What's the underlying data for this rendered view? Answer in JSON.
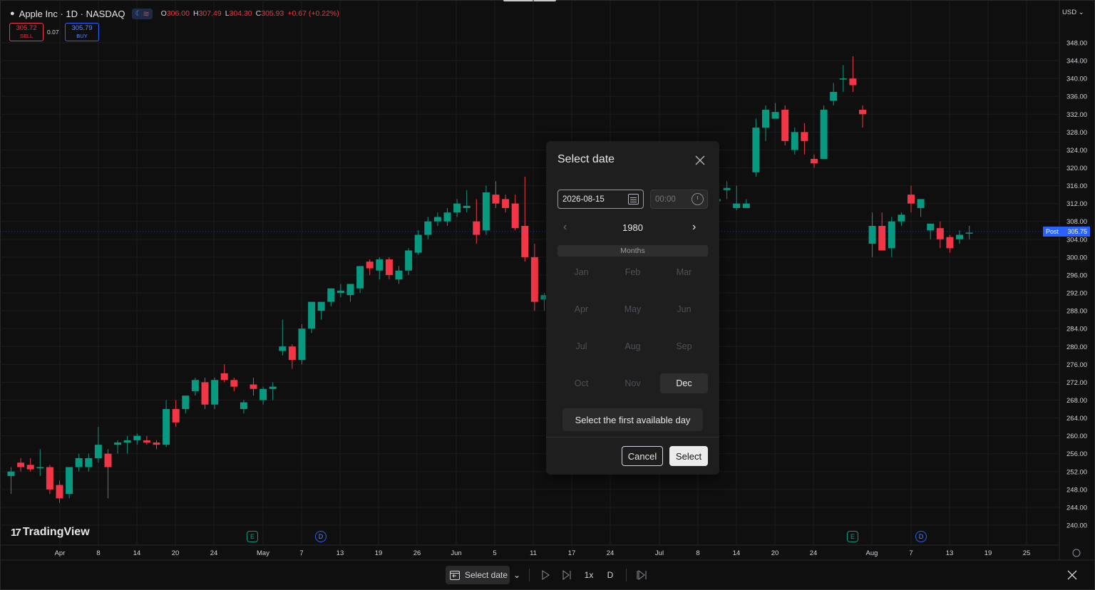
{
  "header": {
    "title": "Apple Inc · 1D · NASDAQ",
    "ohlc": [
      {
        "key": "O",
        "value": "306.00"
      },
      {
        "key": "H",
        "value": "307.49"
      },
      {
        "key": "L",
        "value": "304.30"
      },
      {
        "key": "C",
        "value": "305.93"
      },
      {
        "key": "",
        "value": "+0.67 (+0.22%)"
      }
    ]
  },
  "trade": {
    "sell_price": "305.72",
    "sell_label": "SELL",
    "spread": "0.07",
    "buy_price": "305.79",
    "buy_label": "BUY"
  },
  "currency": "USD ⌄",
  "post_label": {
    "tag": "Post",
    "price": "305.75"
  },
  "logo": {
    "text": "TradingView",
    "mark": "17"
  },
  "events": [
    {
      "type": "E",
      "label": "E"
    },
    {
      "type": "D",
      "label": "D"
    },
    {
      "type": "E",
      "label": "E"
    },
    {
      "type": "D",
      "label": "D"
    }
  ],
  "chart_data": {
    "type": "candlestick",
    "title": "Apple Inc · 1D · NASDAQ",
    "ylim": [
      238,
      350
    ],
    "y_ticks": [
      "348.00",
      "344.00",
      "340.00",
      "336.00",
      "332.00",
      "328.00",
      "324.00",
      "320.00",
      "316.00",
      "312.00",
      "308.00",
      "304.00",
      "300.00",
      "296.00",
      "292.00",
      "288.00",
      "284.00",
      "280.00",
      "276.00",
      "272.00",
      "268.00",
      "264.00",
      "260.00",
      "256.00",
      "252.00",
      "248.00",
      "244.00",
      "240.00"
    ],
    "x_ticks": [
      "Apr",
      "8",
      "14",
      "20",
      "24",
      "May",
      "7",
      "13",
      "19",
      "26",
      "Jun",
      "5",
      "11",
      "17",
      "24",
      "Jul",
      "8",
      "14",
      "20",
      "24",
      "Aug",
      "7",
      "13",
      "19",
      "25"
    ],
    "colors": {
      "up": "#089981",
      "down": "#f23645",
      "grid": "#1c1c1c",
      "background": "#0f0f0f"
    },
    "candles": [
      [
        251.0,
        253.0,
        247.0,
        252.0
      ],
      [
        254.0,
        255.0,
        252.0,
        253.0
      ],
      [
        253.5,
        255.0,
        252.0,
        252.5
      ],
      [
        253.0,
        257.0,
        251.0,
        253.0
      ],
      [
        253.0,
        253.5,
        247.0,
        248.0
      ],
      [
        249.0,
        250.0,
        245.0,
        246.0
      ],
      [
        247.0,
        253.0,
        246.0,
        253.0
      ],
      [
        253.0,
        256.0,
        252.0,
        255.0
      ],
      [
        253.0,
        256.0,
        252.0,
        255.0
      ],
      [
        255.0,
        262.0,
        254.0,
        258.0
      ],
      [
        256.0,
        257.0,
        246.0,
        253.0
      ],
      [
        258.0,
        259.0,
        256.0,
        258.5
      ],
      [
        258.5,
        260.0,
        256.0,
        259.0
      ],
      [
        259.0,
        260.5,
        258.0,
        260.0
      ],
      [
        259.0,
        260.0,
        258.0,
        258.5
      ],
      [
        258.5,
        259.0,
        257.0,
        258.0
      ],
      [
        258.0,
        268.0,
        257.5,
        266.0
      ],
      [
        266.0,
        268.0,
        262.0,
        263.0
      ],
      [
        266.0,
        269.0,
        265.0,
        269.0
      ],
      [
        270.0,
        273.0,
        269.0,
        272.5
      ],
      [
        272.0,
        273.0,
        266.0,
        267.0
      ],
      [
        267.0,
        273.0,
        266.0,
        272.5
      ],
      [
        274.0,
        276.0,
        272.0,
        272.5
      ],
      [
        272.5,
        273.0,
        270.0,
        271.0
      ],
      [
        266.0,
        268.0,
        265.0,
        267.5
      ],
      [
        271.5,
        273.0,
        269.0,
        270.5
      ],
      [
        268.0,
        271.0,
        267.0,
        270.5
      ],
      [
        270.5,
        272.0,
        268.0,
        271.0
      ],
      [
        279.0,
        286.0,
        278.0,
        280.0
      ],
      [
        280.0,
        280.5,
        275.0,
        277.0
      ],
      [
        277.0,
        285.0,
        276.0,
        284.0
      ],
      [
        284.0,
        290.0,
        283.0,
        290.0
      ],
      [
        288.0,
        289.0,
        286.0,
        290.0
      ],
      [
        290.0,
        293.0,
        289.0,
        293.0
      ],
      [
        292.0,
        294.0,
        291.0,
        292.5
      ],
      [
        291.5,
        294.0,
        290.0,
        294.0
      ],
      [
        293.0,
        298.0,
        292.0,
        298.0
      ],
      [
        299.0,
        299.5,
        296.0,
        297.5
      ],
      [
        297.0,
        300.0,
        295.0,
        299.5
      ],
      [
        299.5,
        300.0,
        295.0,
        296.0
      ],
      [
        295.0,
        298.0,
        294.0,
        297.0
      ],
      [
        297.0,
        302.0,
        296.0,
        301.5
      ],
      [
        301.0,
        306.0,
        300.5,
        305.0
      ],
      [
        305.0,
        309.0,
        304.0,
        308.0
      ],
      [
        308.0,
        310.0,
        307.0,
        309.0
      ],
      [
        308.0,
        311.0,
        307.0,
        310.0
      ],
      [
        310.0,
        313.0,
        309.0,
        312.0
      ],
      [
        311.0,
        315.0,
        310.0,
        311.5
      ],
      [
        308.0,
        313.0,
        303.0,
        305.0
      ],
      [
        306.0,
        316.0,
        305.0,
        314.5
      ],
      [
        314.0,
        317.0,
        311.0,
        312.0
      ],
      [
        313.0,
        314.0,
        310.0,
        311.0
      ],
      [
        312.0,
        314.0,
        306.0,
        306.5
      ],
      [
        307.0,
        318.0,
        299.0,
        300.0
      ],
      [
        300.0,
        303.0,
        288.0,
        290.0
      ],
      [
        290.5,
        292.0,
        288.0,
        291.5
      ],
      [
        293.0,
        296.0,
        292.0,
        295.0
      ],
      [
        295.0,
        296.0,
        289.0,
        290.0
      ]
    ],
    "candles_right": [
      [
        312.5,
        315.0,
        312.0,
        313.0
      ],
      [
        315.0,
        317.0,
        313.0,
        315.5
      ],
      [
        311.0,
        316.0,
        310.5,
        312.0
      ],
      [
        311.0,
        313.0,
        311.0,
        312.0
      ],
      [
        319.0,
        331.0,
        318.0,
        329.0
      ],
      [
        329.0,
        334.0,
        326.0,
        333.0
      ],
      [
        331.0,
        334.5,
        331.0,
        332.5
      ],
      [
        333.0,
        334.0,
        325.0,
        326.0
      ],
      [
        324.0,
        329.0,
        323.0,
        328.0
      ],
      [
        328.0,
        330.0,
        323.0,
        326.0
      ],
      [
        322.0,
        323.0,
        320.0,
        321.0
      ],
      [
        322.0,
        334.0,
        322.0,
        333.0
      ],
      [
        335.0,
        339.0,
        334.0,
        337.0
      ],
      [
        340.0,
        343.0,
        337.0,
        340.0
      ],
      [
        340.0,
        345.0,
        337.0,
        338.5
      ],
      [
        333.0,
        334.0,
        329.0,
        332.0
      ],
      [
        303.0,
        310.0,
        300.0,
        307.0
      ],
      [
        307.0,
        310.0,
        302.0,
        301.5
      ],
      [
        302.0,
        309.0,
        300.0,
        308.0
      ],
      [
        308.0,
        310.0,
        307.0,
        309.5
      ],
      [
        314.0,
        316.0,
        310.0,
        312.0
      ],
      [
        311.0,
        312.0,
        309.0,
        313.0
      ],
      [
        306.0,
        307.0,
        304.0,
        307.5
      ],
      [
        306.5,
        308.0,
        302.0,
        304.0
      ],
      [
        304.5,
        305.0,
        301.0,
        302.0
      ],
      [
        304.0,
        306.0,
        303.0,
        305.0
      ],
      [
        305.5,
        307.0,
        304.0,
        305.5
      ]
    ]
  },
  "dialog": {
    "title": "Select date",
    "date_value": "2026-08-15",
    "time_placeholder": "00:00",
    "year": "1980",
    "months_header": "Months",
    "months": [
      "Jan",
      "Feb",
      "Mar",
      "Apr",
      "May",
      "Jun",
      "Jul",
      "Aug",
      "Sep",
      "Oct",
      "Nov",
      "Dec"
    ],
    "selected_month": "Dec",
    "first_day_label": "Select the first available day",
    "cancel_label": "Cancel",
    "select_label": "Select"
  },
  "toolbar": {
    "select_date_label": "Select date",
    "speed_label": "1x",
    "interval_label": "D"
  }
}
